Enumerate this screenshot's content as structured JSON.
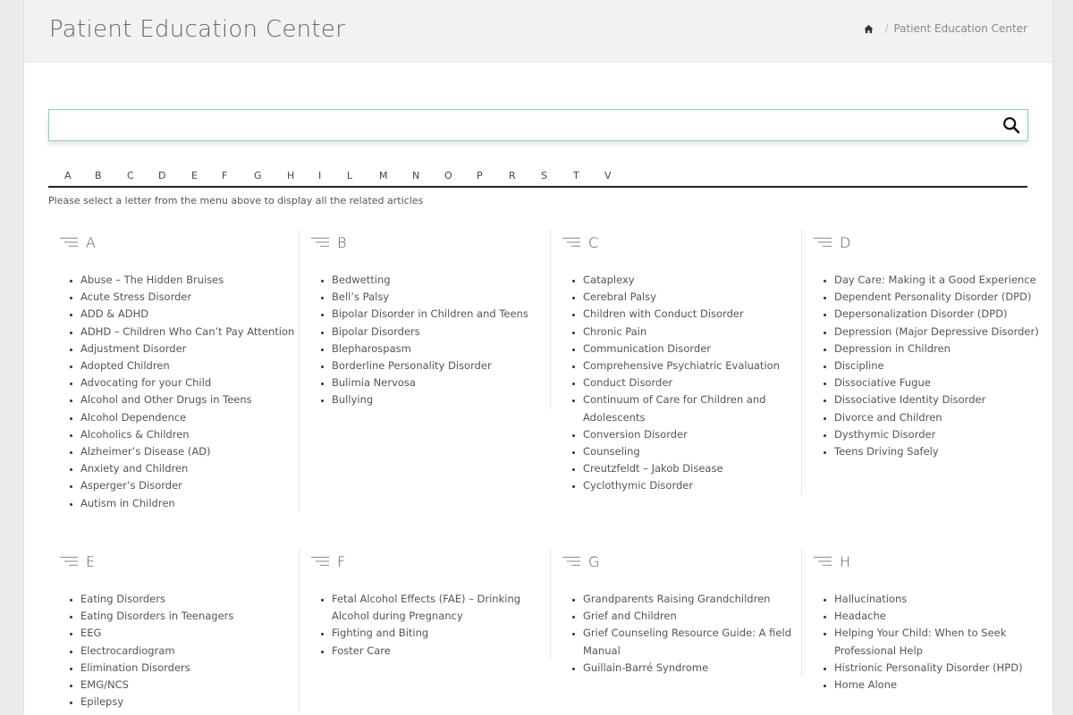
{
  "header": {
    "title": "Patient Education Center",
    "breadcrumb": {
      "home_icon": "home-icon",
      "current": "Patient Education Center"
    }
  },
  "search": {
    "placeholder": "",
    "value": "",
    "icon": "search-icon"
  },
  "letters": [
    "A",
    "B",
    "C",
    "D",
    "E",
    "F",
    "G",
    "H",
    "I",
    "L",
    "M",
    "N",
    "O",
    "P",
    "R",
    "S",
    "T",
    "V"
  ],
  "hint": "Please select a letter from the menu above to display all the related articles",
  "colors": {
    "accent_border": "#8fd3a4",
    "header_bg": "#f2f2f2",
    "page_bg": "#ebebeb"
  },
  "sections": [
    {
      "letter": "A",
      "items": [
        "Abuse – The Hidden Bruises",
        "Acute Stress Disorder",
        "ADD & ADHD",
        "ADHD – Children Who Can’t Pay Attention",
        "Adjustment Disorder",
        "Adopted Children",
        "Advocating for your Child",
        "Alcohol and Other Drugs in Teens",
        "Alcohol Dependence",
        "Alcoholics & Children",
        "Alzheimer’s Disease (AD)",
        "Anxiety and Children",
        "Asperger’s Disorder",
        "Autism in Children"
      ]
    },
    {
      "letter": "B",
      "items": [
        "Bedwetting",
        "Bell’s Palsy",
        "Bipolar Disorder in Children and Teens",
        "Bipolar Disorders",
        "Blepharospasm",
        "Borderline Personality Disorder",
        "Bulimia Nervosa",
        "Bullying"
      ]
    },
    {
      "letter": "C",
      "items": [
        "Cataplexy",
        "Cerebral Palsy",
        "Children with Conduct Disorder",
        "Chronic Pain",
        "Communication Disorder",
        "Comprehensive Psychiatric Evaluation",
        "Conduct Disorder",
        "Continuum of Care for Children and Adolescents",
        "Conversion Disorder",
        "Counseling",
        "Creutzfeldt – Jakob Disease",
        "Cyclothymic Disorder"
      ]
    },
    {
      "letter": "D",
      "items": [
        "Day Care: Making it a Good Experience",
        "Dependent Personality Disorder (DPD)",
        "Depersonalization Disorder (DPD)",
        "Depression (Major Depressive Disorder)",
        "Depression in Children",
        "Discipline",
        "Dissociative Fugue",
        "Dissociative Identity Disorder",
        "Divorce and Children",
        "Dysthymic Disorder",
        "Teens Driving Safely"
      ]
    },
    {
      "letter": "E",
      "items": [
        "Eating Disorders",
        "Eating Disorders in Teenagers",
        "EEG",
        "Electrocardiogram",
        "Elimination Disorders",
        "EMG/NCS",
        "Epilepsy"
      ]
    },
    {
      "letter": "F",
      "items": [
        "Fetal Alcohol Effects (FAE) – Drinking Alcohol during Pregnancy",
        "Fighting and Biting",
        "Foster Care"
      ]
    },
    {
      "letter": "G",
      "items": [
        "Grandparents Raising Grandchildren",
        "Grief and Children",
        "Grief Counseling Resource Guide: A field Manual",
        "Guillain-Barré Syndrome"
      ]
    },
    {
      "letter": "H",
      "items": [
        "Hallucinations",
        "Headache",
        "Helping Your Child: When to Seek Professional Help",
        "Histrionic Personality Disorder (HPD)",
        "Home Alone"
      ]
    }
  ]
}
